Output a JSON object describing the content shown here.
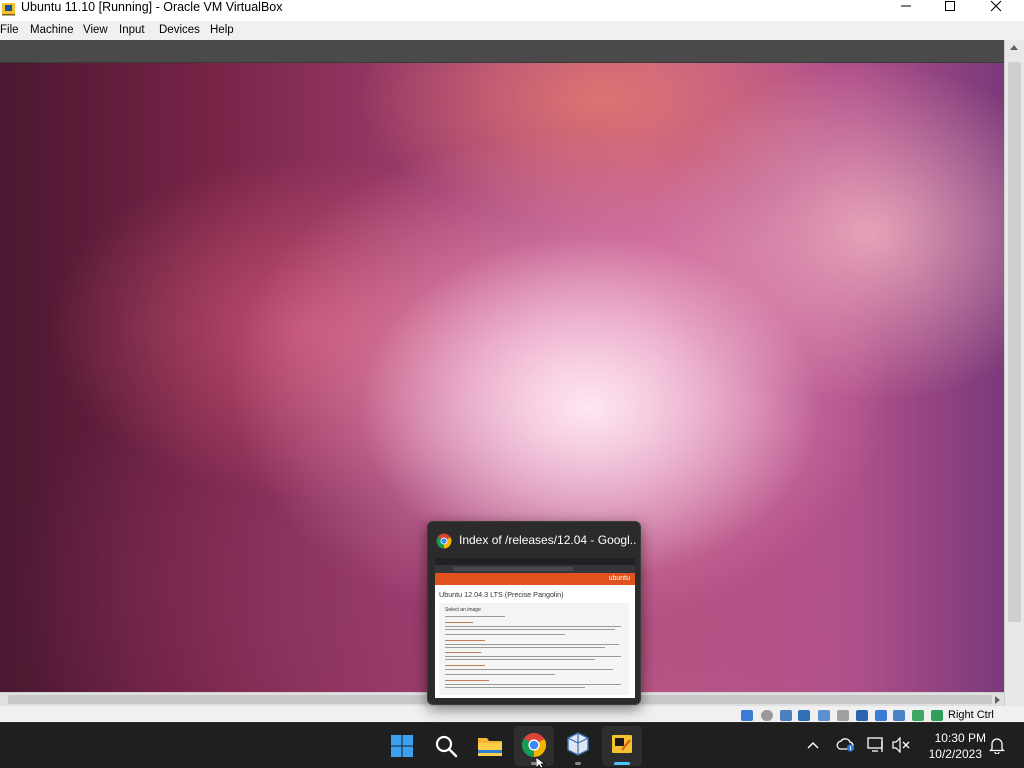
{
  "window": {
    "title": "Ubuntu 11.10 [Running] - Oracle VM VirtualBox"
  },
  "menu": {
    "file": "File",
    "machine": "Machine",
    "view": "View",
    "input": "Input",
    "devices": "Devices",
    "help": "Help"
  },
  "statusbar": {
    "host_key": "Right Ctrl",
    "icons": [
      "hard-disk-icon",
      "optical-drive-icon",
      "audio-icon",
      "network-icon",
      "usb-icon",
      "shared-folders-icon",
      "display-icon",
      "video-capture-icon",
      "cpu-icon",
      "mouse-integration-icon",
      "host-key-icon"
    ]
  },
  "preview": {
    "title": "Index of /releases/12.04 - Googl...",
    "page_logo": "ubuntu",
    "page_heading": "Ubuntu 12.04.3 LTS (Precise Pangolin)",
    "page_subheading": "Select an image"
  },
  "taskbar": {
    "apps": [
      "start-icon",
      "search-icon",
      "file-explorer-icon",
      "chrome-icon",
      "virtualbox-icon",
      "vm-window-icon"
    ],
    "tray": [
      "show-hidden-icons-chevron",
      "onedrive-icon",
      "network-icon",
      "volume-muted-icon",
      "notification-bell-icon"
    ],
    "time": "10:30 PM",
    "date": "10/2/2023"
  },
  "colors": {
    "taskbar_bg": "#1f1f1f",
    "accent_indicator": "#4cc2ff",
    "ubuntu_orange": "#e0531f"
  }
}
